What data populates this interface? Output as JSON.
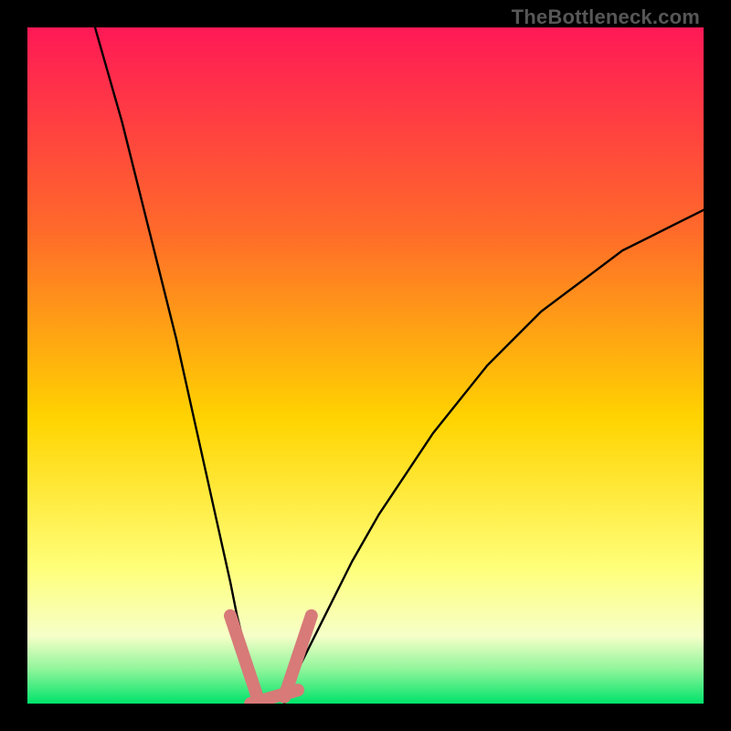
{
  "watermark": "TheBottleneck.com",
  "colors": {
    "bg_black": "#000000",
    "grad_top": "#ff1956",
    "grad_mid1": "#ff6a2a",
    "grad_mid2": "#ffd400",
    "grad_low_yellow": "#ffff7a",
    "grad_pale": "#f6ffc8",
    "grad_green1": "#8ef59a",
    "grad_green2": "#00e36b",
    "curve_stroke": "#000000",
    "blob_fill": "#d77a78"
  },
  "chart_data": {
    "type": "line",
    "title": "",
    "xlabel": "",
    "ylabel": "",
    "xlim": [
      0,
      100
    ],
    "ylim": [
      0,
      100
    ],
    "series": [
      {
        "name": "left-curve",
        "x": [
          10,
          12,
          14,
          16,
          18,
          20,
          22,
          24,
          26,
          28,
          30,
          31,
          32,
          33,
          34,
          34.5
        ],
        "y": [
          100,
          93,
          86,
          78,
          70,
          62,
          54,
          45,
          36,
          27,
          18,
          13,
          9,
          5,
          2,
          0
        ]
      },
      {
        "name": "right-curve",
        "x": [
          38,
          40,
          44,
          48,
          52,
          56,
          60,
          64,
          68,
          72,
          76,
          80,
          84,
          88,
          92,
          96,
          100
        ],
        "y": [
          0,
          5,
          13,
          21,
          28,
          34,
          40,
          45,
          50,
          54,
          58,
          61,
          64,
          67,
          69,
          71,
          73
        ]
      }
    ],
    "valley_markers": {
      "left": {
        "x_range": [
          30,
          34
        ],
        "y_range": [
          1,
          13
        ]
      },
      "floor": {
        "x_range": [
          33,
          40
        ],
        "y_range": [
          0,
          2
        ]
      },
      "right": {
        "x_range": [
          38,
          42
        ],
        "y_range": [
          1,
          13
        ]
      }
    },
    "background_gradient_stops": [
      {
        "pos": 0.0,
        "color": "#ff1956"
      },
      {
        "pos": 0.3,
        "color": "#ff6a2a"
      },
      {
        "pos": 0.58,
        "color": "#ffd400"
      },
      {
        "pos": 0.8,
        "color": "#ffff7a"
      },
      {
        "pos": 0.9,
        "color": "#f6ffc8"
      },
      {
        "pos": 0.95,
        "color": "#8ef59a"
      },
      {
        "pos": 1.0,
        "color": "#00e36b"
      }
    ]
  }
}
